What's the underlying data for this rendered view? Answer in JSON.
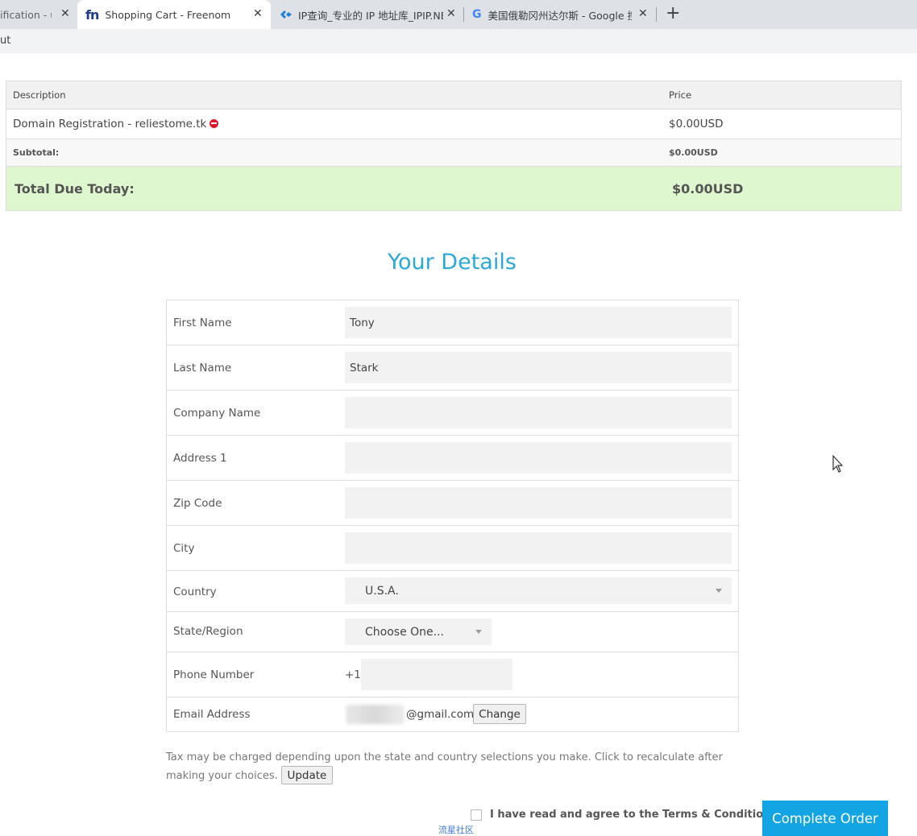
{
  "browser": {
    "tabs": [
      {
        "title": "ification - u",
        "active": false
      },
      {
        "title": "Shopping Cart - Freenom",
        "active": true,
        "icon": "fn"
      },
      {
        "title": "IP查询_专业的 IP 地址库_IPIP.NE",
        "active": false
      },
      {
        "title": "美国俄勒冈州达尔斯 - Google 搜",
        "active": false
      }
    ],
    "bookmark_partial": "ut"
  },
  "cart": {
    "headers": {
      "description": "Description",
      "price": "Price"
    },
    "item": {
      "description": "Domain Registration - reliestome.tk",
      "price": "$0.00USD"
    },
    "subtotal": {
      "label": "Subtotal:",
      "value": "$0.00USD"
    },
    "total": {
      "label": "Total Due Today:",
      "value": "$0.00USD"
    }
  },
  "details": {
    "heading": "Your Details",
    "fields": {
      "first_name": {
        "label": "First Name",
        "value": "Tony"
      },
      "last_name": {
        "label": "Last Name",
        "value": "Stark"
      },
      "company": {
        "label": "Company Name",
        "value": ""
      },
      "address1": {
        "label": "Address 1",
        "value": ""
      },
      "zip": {
        "label": "Zip Code",
        "value": ""
      },
      "city": {
        "label": "City",
        "value": ""
      },
      "country": {
        "label": "Country",
        "value": "U.S.A."
      },
      "state": {
        "label": "State/Region",
        "value": "Choose One..."
      },
      "phone": {
        "label": "Phone Number",
        "prefix": "+1",
        "value": ""
      },
      "email": {
        "label": "Email Address",
        "value": "@gmail.com",
        "change_label": "Change"
      }
    }
  },
  "tax_note": "Tax may be charged depending upon the state and country selections you make. Click to recalculate after making your choices.",
  "update_label": "Update",
  "agree_label": "I have read and agree to the Terms & Conditions",
  "complete_label": "Complete Order",
  "watermark": "流星社区",
  "colors": {
    "accent": "#13a5e3",
    "heading": "#2aa9d8",
    "total_bg": "#dff7cf",
    "remove": "#e0182d"
  }
}
